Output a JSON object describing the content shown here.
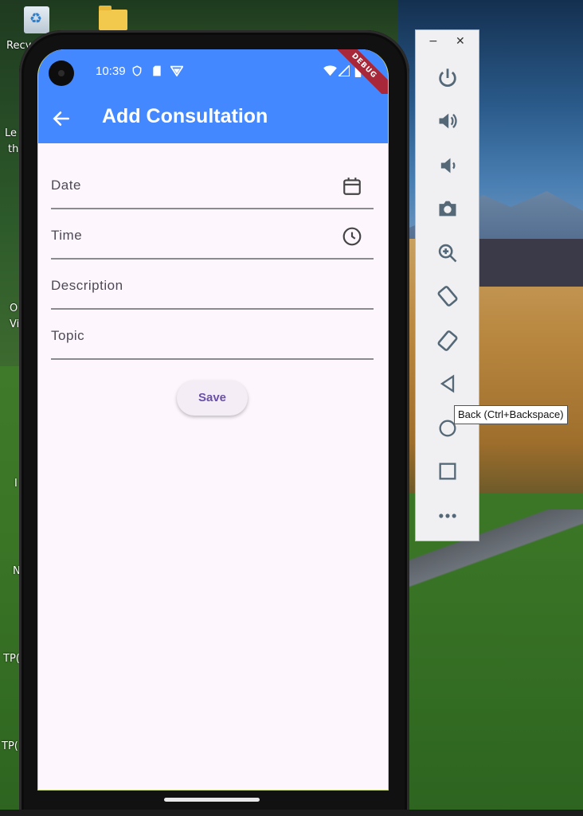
{
  "desktop": {
    "icons": [
      {
        "label": "Recy"
      },
      {
        "label": ""
      }
    ],
    "side_labels": [
      "Le",
      "th",
      "O",
      "Vi",
      "I",
      "N",
      "TP(",
      "TP("
    ]
  },
  "phone": {
    "status_bar": {
      "time": "10:39",
      "debug_banner": "DEBUG"
    },
    "app_bar": {
      "title": "Add Consultation"
    },
    "form": {
      "fields": [
        {
          "label": "Date",
          "icon": "calendar-icon"
        },
        {
          "label": "Time",
          "icon": "clock-icon"
        },
        {
          "label": "Description",
          "icon": ""
        },
        {
          "label": "Topic",
          "icon": ""
        }
      ],
      "save_label": "Save"
    },
    "colors": {
      "primary": "#4488ff",
      "background": "#fdf7fd",
      "button_text": "#6a50a8"
    }
  },
  "emulator_toolbar": {
    "window_controls": [
      "−",
      "✕"
    ],
    "buttons": [
      "power-icon",
      "volume-up-icon",
      "volume-down-icon",
      "camera-icon",
      "zoom-icon",
      "rotate-left-icon",
      "rotate-right-icon",
      "back-icon",
      "home-icon",
      "overview-icon",
      "more-icon"
    ],
    "tooltip": "Back (Ctrl+Backspace)"
  }
}
